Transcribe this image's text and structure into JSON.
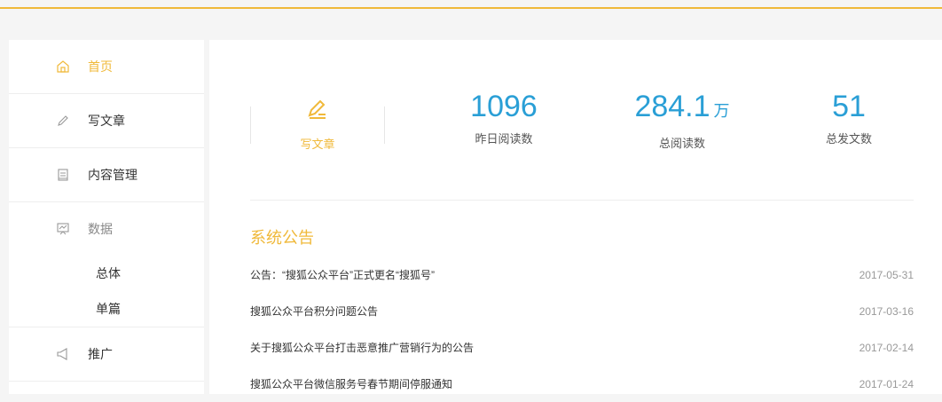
{
  "sidebar": {
    "items": [
      {
        "label": "首页",
        "icon": "home-icon"
      },
      {
        "label": "写文章",
        "icon": "pencil-icon"
      },
      {
        "label": "内容管理",
        "icon": "document-icon"
      },
      {
        "label": "数据",
        "icon": "chart-board-icon"
      },
      {
        "label": "推广",
        "icon": "megaphone-icon"
      }
    ],
    "data_sub": [
      "总体",
      "单篇"
    ]
  },
  "stats": {
    "write_label": "写文章",
    "yesterday_reads": "1096",
    "yesterday_label": "昨日阅读数",
    "total_reads": "284.1",
    "total_unit": "万",
    "total_label": "总阅读数",
    "total_posts": "51",
    "posts_label": "总发文数"
  },
  "notices": {
    "title": "系统公告",
    "items": [
      {
        "title": "公告：“搜狐公众平台”正式更名“搜狐号”",
        "date": "2017-05-31"
      },
      {
        "title": "搜狐公众平台积分问题公告",
        "date": "2017-03-16"
      },
      {
        "title": "关于搜狐公众平台打击恶意推广营销行为的公告",
        "date": "2017-02-14"
      },
      {
        "title": "搜狐公众平台微信服务号春节期间停服通知",
        "date": "2017-01-24"
      }
    ]
  },
  "colors": {
    "accent": "#f0b93a",
    "number": "#2a9fd6"
  }
}
